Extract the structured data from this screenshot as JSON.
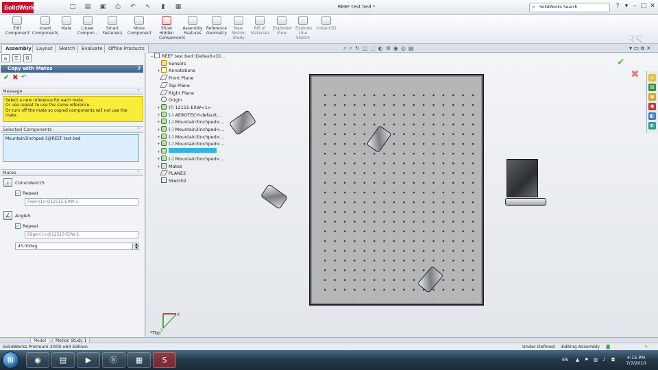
{
  "app": {
    "logo_text": "SolidWorks",
    "document_title": "REEF test bed *",
    "search_placeholder": "SolidWorks Search"
  },
  "ribbon": {
    "buttons": [
      {
        "label": "Edit\nComponent",
        "icon": "edit-component-icon"
      },
      {
        "label": "Insert\nComponents",
        "icon": "insert-components-icon"
      },
      {
        "label": "Mate",
        "icon": "mate-icon"
      },
      {
        "label": "Linear\nCompon...",
        "icon": "linear-pattern-icon"
      },
      {
        "label": "Smart\nFasteners",
        "icon": "smart-fasteners-icon"
      },
      {
        "label": "Move\nComponent",
        "icon": "move-component-icon"
      },
      {
        "label": "Show\nHidden\nComponents",
        "icon": "show-hidden-icon"
      },
      {
        "label": "Assembly\nFeatures",
        "icon": "assembly-features-icon"
      },
      {
        "label": "Reference\nGeometry",
        "icon": "reference-geometry-icon"
      },
      {
        "label": "New\nMotion\nStudy",
        "icon": "motion-study-icon"
      },
      {
        "label": "Bill of\nMaterials",
        "icon": "bom-icon"
      },
      {
        "label": "Exploded\nView",
        "icon": "exploded-view-icon"
      },
      {
        "label": "Explode\nLine\nSketch",
        "icon": "explode-line-icon"
      },
      {
        "label": "Instant3D",
        "icon": "instant3d-icon"
      }
    ]
  },
  "tabs": [
    "Assembly",
    "Layout",
    "Sketch",
    "Evaluate",
    "Office Products"
  ],
  "panel": {
    "title": "Copy with Mates",
    "message_header": "Message",
    "message_lines": [
      "Select a new reference for each mate.",
      "Or use repeat to use the same reference.",
      "Or turn off the mate so copied components will not use the",
      "mate."
    ],
    "selected_header": "Selected Components",
    "selected_item": "Mountain3inchped-3@REEF test bed",
    "mates_header": "Mates",
    "mates": [
      {
        "name": "Coincident15",
        "repeat_label": "Repeat",
        "reference": "Face<1>@12515-E0W-1"
      },
      {
        "name": "Angle5",
        "repeat_label": "Repeat",
        "reference": "Edge<1>@12515-E0W-1"
      }
    ],
    "angle_value": "45.00deg"
  },
  "tree": [
    {
      "label": "REEF test bed  (Default<Di...",
      "icon": "assembly",
      "exp": "−"
    },
    {
      "label": "Sensors",
      "icon": "sensor",
      "exp": ""
    },
    {
      "label": "Annotations",
      "icon": "annot",
      "exp": "+"
    },
    {
      "label": "Front Plane",
      "icon": "plane",
      "exp": ""
    },
    {
      "label": "Top Plane",
      "icon": "plane",
      "exp": ""
    },
    {
      "label": "Right Plane",
      "icon": "plane",
      "exp": ""
    },
    {
      "label": "Origin",
      "icon": "orig",
      "exp": ""
    },
    {
      "label": "(f) 12115-E0W<1>",
      "icon": "part",
      "exp": "+"
    },
    {
      "label": "(-) AEROTECH-default...",
      "icon": "part",
      "exp": "+"
    },
    {
      "label": "(-) Mountain3inchped<...",
      "icon": "part",
      "exp": "+"
    },
    {
      "label": "(-) Mountain2inchped<...",
      "icon": "part",
      "exp": "+"
    },
    {
      "label": "(-) Mountain3inchped<...",
      "icon": "part",
      "exp": "+"
    },
    {
      "label": "(-) Mountain3inchped<...",
      "icon": "part",
      "exp": "+"
    },
    {
      "label": "",
      "icon": "part",
      "exp": "+"
    },
    {
      "label": "(-) Mountain3inchped<...",
      "icon": "part",
      "exp": "+"
    },
    {
      "label": "Mates",
      "icon": "mates",
      "exp": "+"
    },
    {
      "label": "PLANE2",
      "icon": "plane",
      "exp": ""
    },
    {
      "label": "Sketch2",
      "icon": "sketch",
      "exp": ""
    }
  ],
  "viewport": {
    "view_label": "*Top",
    "triad_axes": [
      "X",
      "Y"
    ]
  },
  "bottom_tabs": [
    "Model",
    "Motion Study 1"
  ],
  "status": {
    "edition": "SolidWorks Premium 2009 x64 Edition",
    "state": "Under Defined",
    "mode": "Editing Assembly"
  },
  "taskbar": {
    "apps": [
      "ie-icon",
      "explorer-icon",
      "media-player-icon",
      "hp-icon",
      "network-icon",
      "solidworks-icon"
    ],
    "lang": "EN",
    "time": "4:15 PM",
    "date": "7/7/2010"
  },
  "colors": {
    "message_bg": "#f9ec3b",
    "panel_header": "#3e5f87",
    "accent_red": "#c8102e"
  }
}
